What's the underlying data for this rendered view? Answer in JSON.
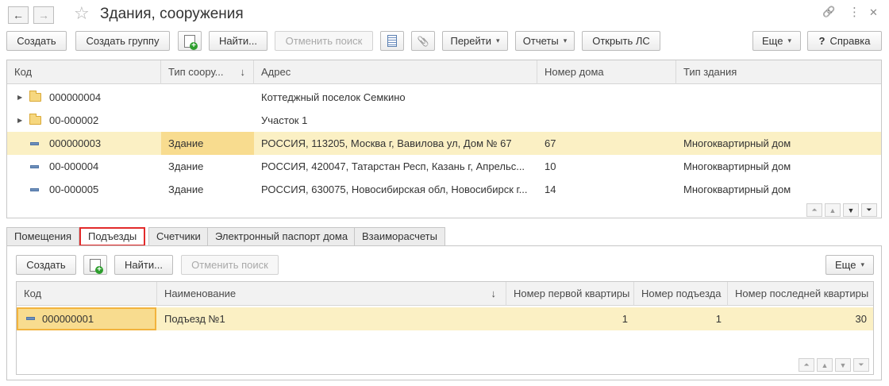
{
  "window": {
    "title": "Здания, сооружения",
    "back_icon": "←",
    "forward_icon": "→",
    "star_icon": "☆",
    "link_icon": "🔗",
    "more_icon": "⋮",
    "close_icon": "✕"
  },
  "toolbar": {
    "create": "Создать",
    "create_group": "Создать группу",
    "find": "Найти...",
    "cancel_search": "Отменить поиск",
    "goto": "Перейти",
    "reports": "Отчеты",
    "open_ls": "Открыть ЛС",
    "more": "Еще",
    "help": "Справка",
    "help_mark": "?",
    "attach_icon": "📎",
    "caret": "▾"
  },
  "main_table": {
    "columns": [
      "Код",
      "Тип соору...",
      "Адрес",
      "Номер дома",
      "Тип здания"
    ],
    "sort_arrow": "↓",
    "rows": [
      {
        "code": "000000004",
        "type": "",
        "address": "Коттеджный поселок Семкино",
        "house": "",
        "building": ""
      },
      {
        "code": "00-000002",
        "type": "",
        "address": "Участок 1",
        "house": "",
        "building": ""
      },
      {
        "code": "000000003",
        "type": "Здание",
        "address": "РОССИЯ, 113205, Москва г, Вавилова ул, Дом № 67",
        "house": "67",
        "building": "Многоквартирный дом"
      },
      {
        "code": "00-000004",
        "type": "Здание",
        "address": "РОССИЯ, 420047, Татарстан Респ, Казань г, Апрельс...",
        "house": "10",
        "building": "Многоквартирный дом"
      },
      {
        "code": "00-000005",
        "type": "Здание",
        "address": "РОССИЯ, 630075, Новосибирская обл, Новосибирск г...",
        "house": "14",
        "building": "Многоквартирный дом"
      }
    ],
    "expand_arrow": "▶"
  },
  "tabs": [
    "Помещения",
    "Подъезды",
    "Счетчики",
    "Электронный паспорт дома",
    "Взаиморасчеты"
  ],
  "sub_toolbar": {
    "create": "Создать",
    "find": "Найти...",
    "cancel_search": "Отменить поиск",
    "more": "Еще"
  },
  "sub_table": {
    "columns": [
      "Код",
      "Наименование",
      "Номер первой квартиры",
      "Номер подъезда",
      "Номер последней квартиры"
    ],
    "sort_arrow": "↓",
    "rows": [
      {
        "code": "000000001",
        "name": "Подъезд №1",
        "first_flat": "1",
        "entrance": "1",
        "last_flat": "30"
      }
    ]
  },
  "scroll": {
    "first": "⏶",
    "up": "▲",
    "down": "▼",
    "last": "⏷"
  }
}
